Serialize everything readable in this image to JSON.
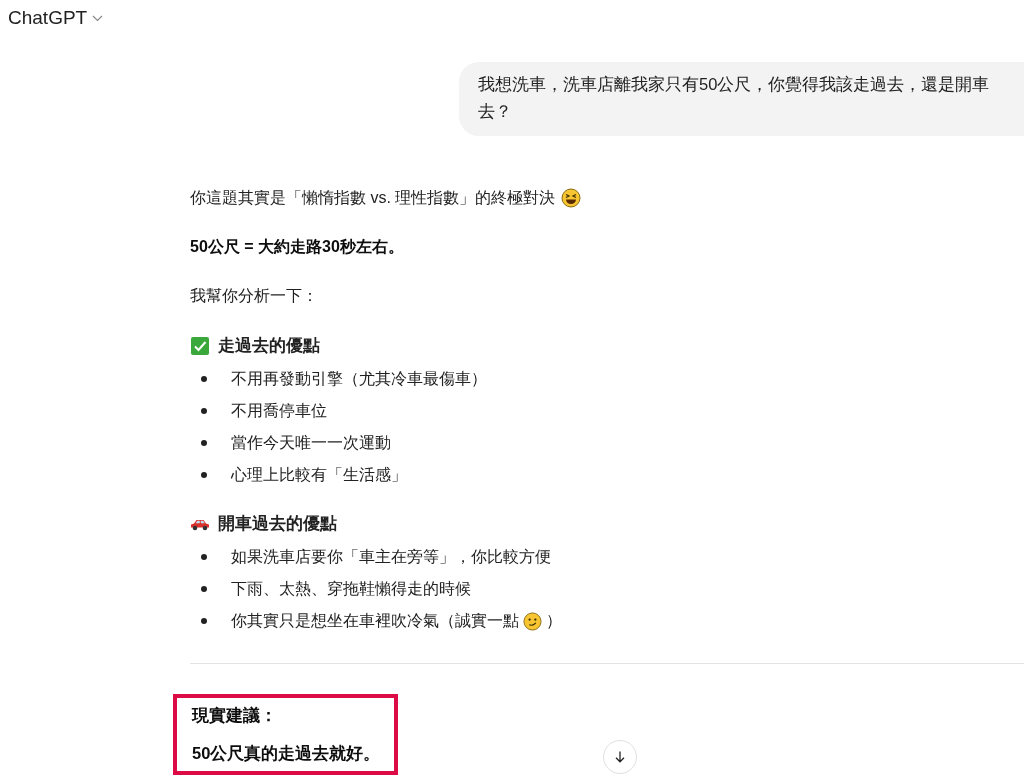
{
  "header": {
    "title": "ChatGPT"
  },
  "user_message": {
    "text": "我想洗車，洗車店離我家只有50公尺，你覺得我該走過去，還是開車去？"
  },
  "assistant_blocks": [
    {
      "kind": "paragraph",
      "text": "你這題其實是「懶惰指數 vs. 理性指數」的終極對決"
    },
    {
      "kind": "paragraph",
      "text": "50公尺 = 大約走路30秒左右。",
      "bold": true
    },
    {
      "kind": "paragraph",
      "text": "我幫你分析一下："
    },
    {
      "kind": "heading",
      "text": "走過去的優點"
    },
    {
      "kind": "list",
      "items": [
        {
          "text": "不用再發動引擎（尤其冷車最傷車）"
        },
        {
          "text": "不用喬停車位"
        },
        {
          "text": "當作今天唯一一次運動"
        },
        {
          "text": "心理上比較有「生活感」"
        }
      ]
    },
    {
      "kind": "heading",
      "text": "開車過去的優點"
    },
    {
      "kind": "list",
      "items": [
        {
          "text": "如果洗車店要你「車主在旁等」，你比較方便"
        },
        {
          "text": "下雨、太熱、穿拖鞋懶得走的時候"
        },
        {
          "text": "你其實只是想坐在車裡吹冷氣（誠實一點",
          "tail": "）"
        }
      ]
    },
    {
      "kind": "divider"
    },
    {
      "kind": "callout",
      "highlighted": true,
      "lines": [
        "現實建議：",
        "50公尺真的走過去就好。"
      ]
    }
  ]
}
